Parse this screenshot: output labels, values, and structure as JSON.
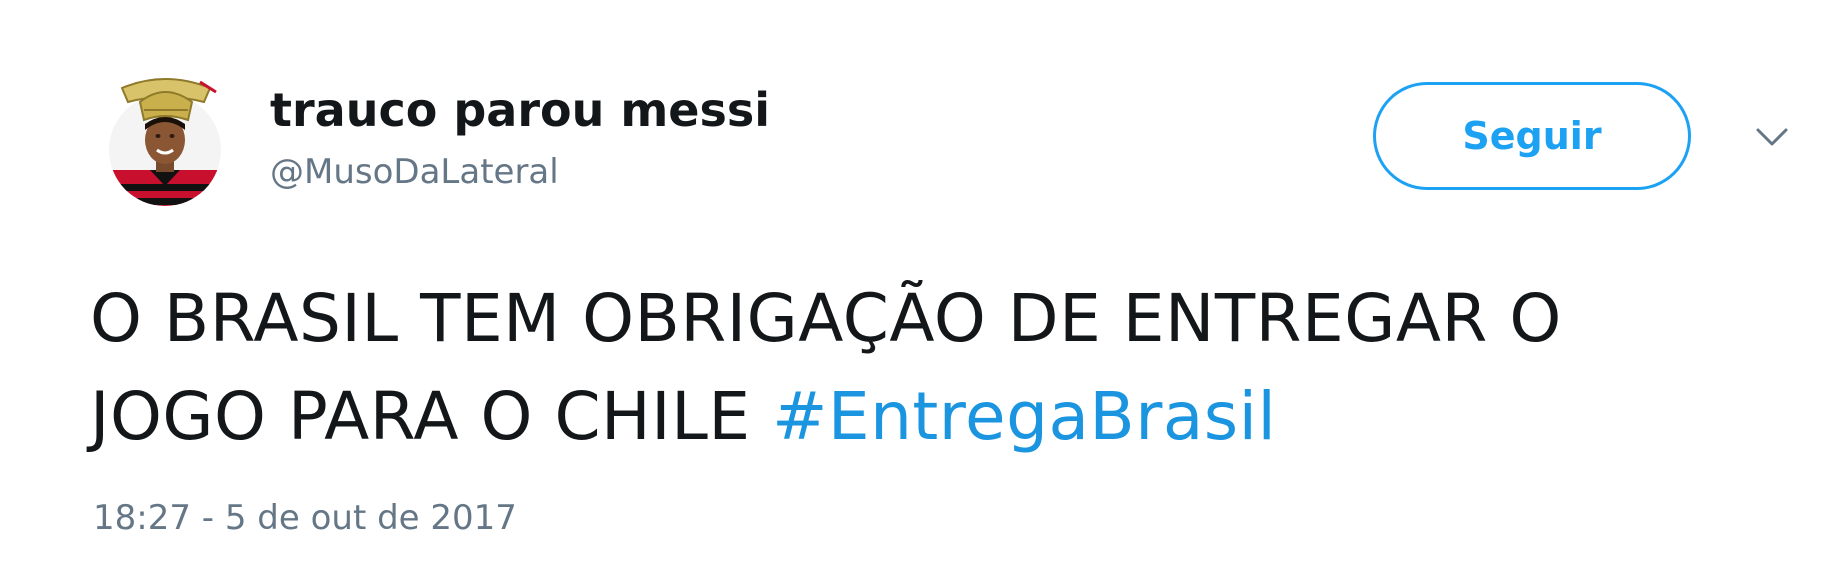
{
  "tweet": {
    "author": {
      "display_name": "trauco parou messi",
      "username": "@MusoDaLateral"
    },
    "follow_label": "Seguir",
    "text_lines": [
      "O BRASIL TEM OBRIGAÇÃO DE ENTREGAR O",
      "JOGO PARA O CHILE "
    ],
    "hashtag": "#EntregaBrasil",
    "timestamp": "18:27 - 5 de out de 2017"
  },
  "colors": {
    "accent": "#1da1f2",
    "hashtag": "#1b95e0",
    "text": "#14171a",
    "secondary_text": "#657786"
  },
  "icons": {
    "caret": "chevron-down-icon",
    "avatar": "avatar-icon"
  }
}
